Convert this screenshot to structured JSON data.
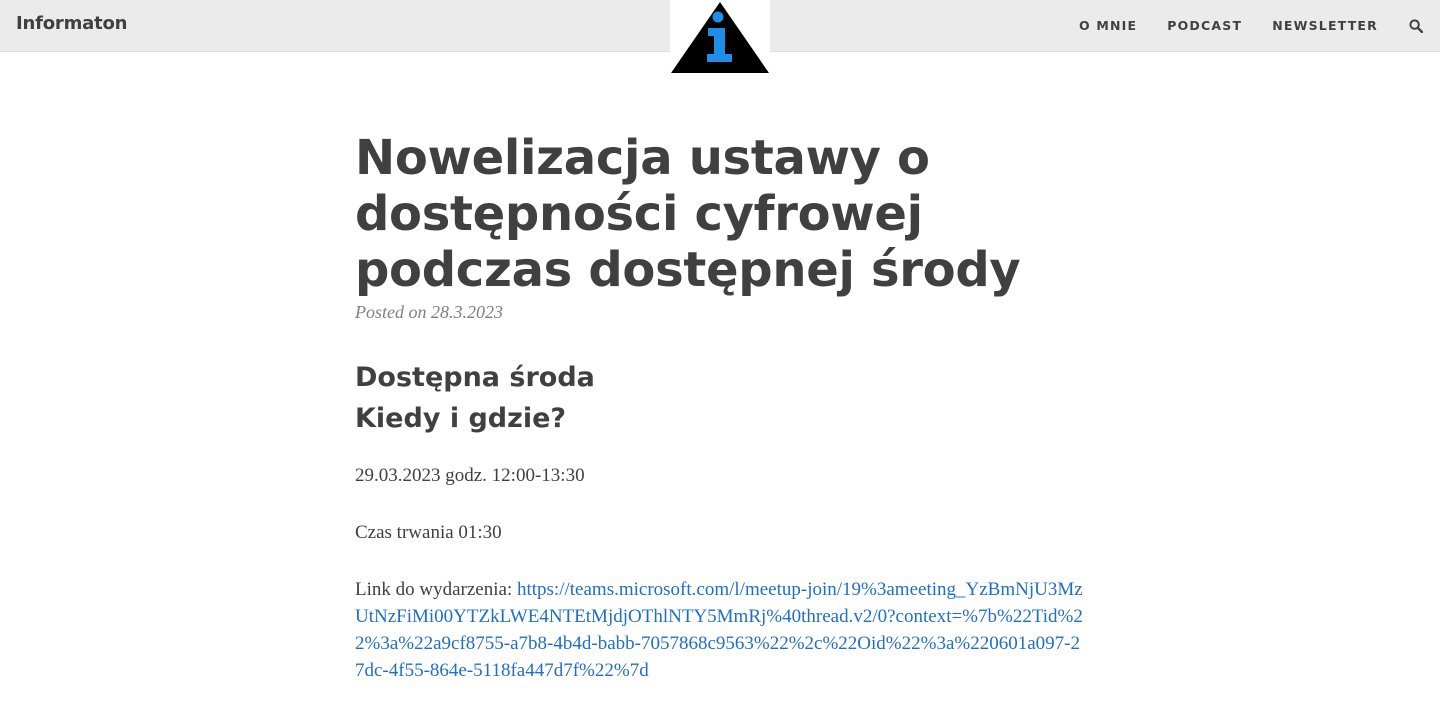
{
  "header": {
    "site_title": "Informaton",
    "logo_icon": "info-triangle-icon",
    "accent_color": "#1e8fe6",
    "nav": [
      {
        "label": "O MNIE"
      },
      {
        "label": "PODCAST"
      },
      {
        "label": "NEWSLETTER"
      }
    ],
    "search_icon": "search-icon"
  },
  "post": {
    "title": "Nowelizacja ustawy o dostępności cyfrowej podczas dostępnej środy",
    "meta": "Posted on 28.3.2023",
    "section_heading_line1": "Dostępna środa",
    "section_heading_line2": "Kiedy i gdzie?",
    "date_time": "29.03.2023 godz. 12:00-13:30",
    "duration": "Czas trwania 01:30",
    "link_label": "Link do wydarzenia: ",
    "link_text": "https://teams.microsoft.com/l/meetup-join/19%3ameeting_YzBmNjU3MzUtNzFiMi00YTZkLWE4NTEtMjdjOThlNTY5MmRj%40thread.v2/0?context=%7b%22Tid%22%3a%22a9cf8755-a7b8-4b4d-babb-7057868c9563%22%2c%22Oid%22%3a%220601a097-27dc-4f55-864e-5118fa447d7f%22%7d",
    "link_color": "#1f6fc7"
  }
}
